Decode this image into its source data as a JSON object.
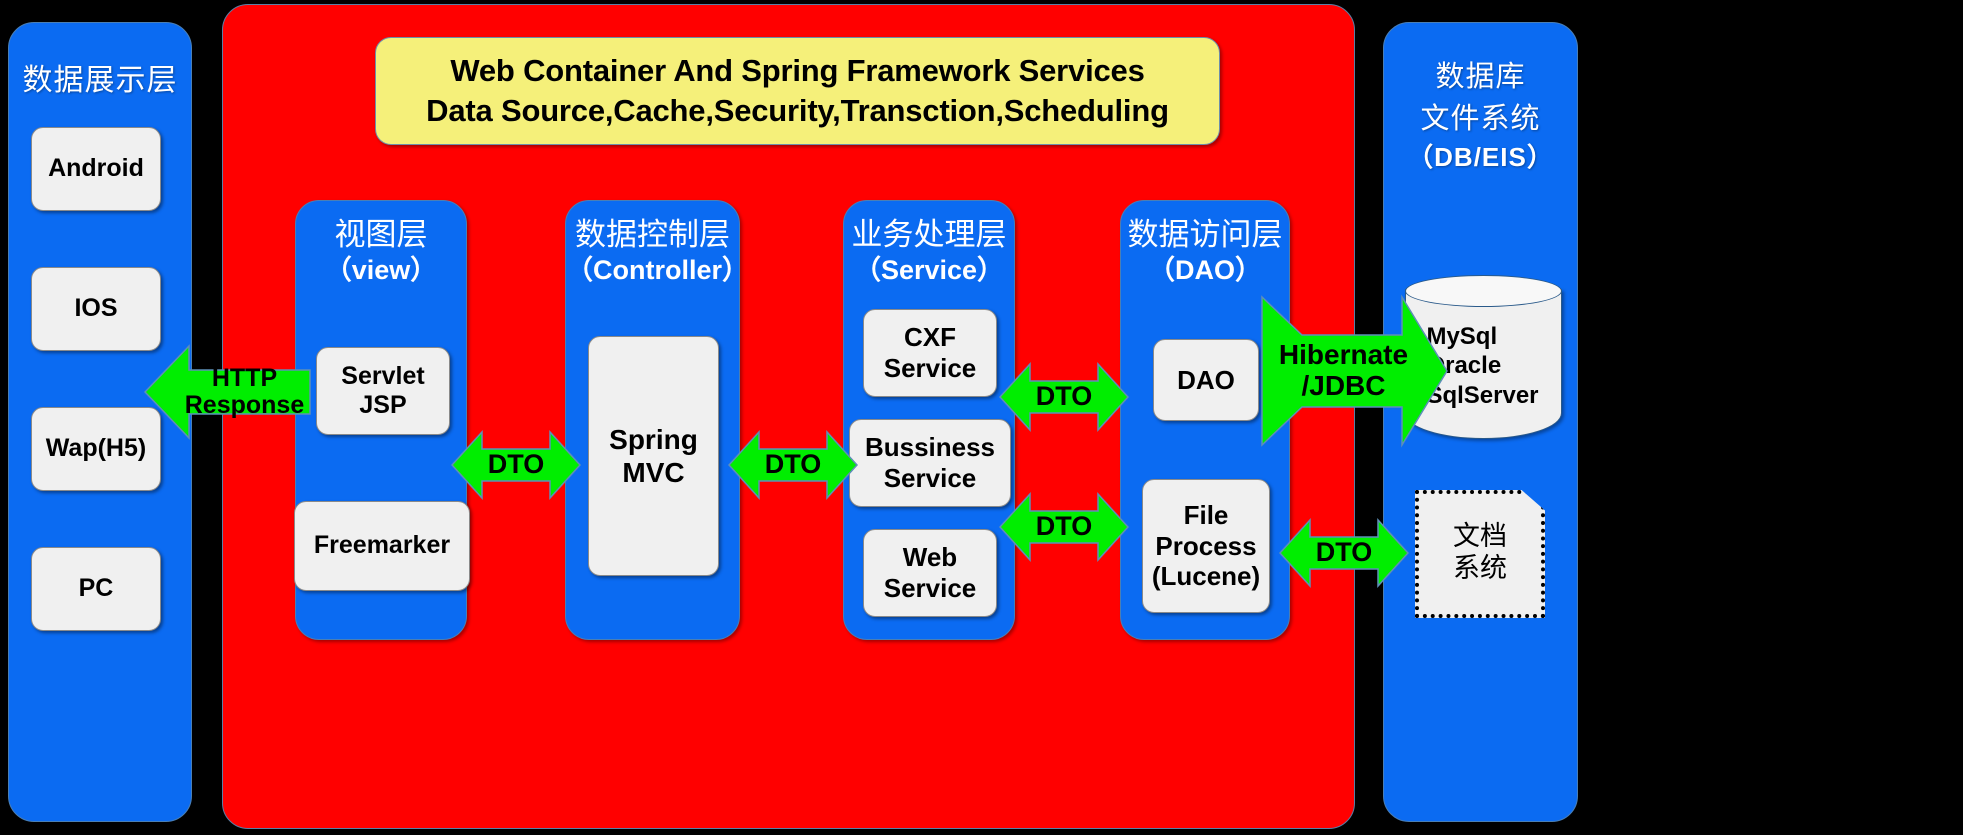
{
  "presentation": {
    "title": "数据展示层",
    "clients": [
      {
        "label": "Android"
      },
      {
        "label": "IOS"
      },
      {
        "label": "Wap(H5)"
      },
      {
        "label": "PC"
      }
    ]
  },
  "container": {
    "banner": {
      "line1": "Web Container And Spring Framework Services",
      "line2": "Data Source,Cache,Security,Transction,Scheduling",
      "color": "#F5F07A"
    },
    "layers": [
      {
        "id": "view",
        "title_cn": "视图层",
        "title_en": "（view）",
        "items": [
          {
            "label": "Servlet\nJSP"
          },
          {
            "label": "Freemarker"
          }
        ]
      },
      {
        "id": "controller",
        "title_cn": "数据控制层",
        "title_en": "（Controller）",
        "items": [
          {
            "label": "Spring\nMVC"
          }
        ]
      },
      {
        "id": "service",
        "title_cn": "业务处理层",
        "title_en": "（Service）",
        "items": [
          {
            "label": "CXF\nService"
          },
          {
            "label": "Bussiness\nService"
          },
          {
            "label": "Web\nService"
          }
        ]
      },
      {
        "id": "dao",
        "title_cn": "数据访问层",
        "title_en": "（DAO）",
        "items": [
          {
            "label": "DAO"
          },
          {
            "label": "File\nProcess\n(Lucene)"
          }
        ]
      }
    ]
  },
  "database": {
    "title_cn1": "数据库",
    "title_cn2": "文件系统",
    "title_en": "（DB/EIS）",
    "mysql": "MySql\nOracle\nSqlServer",
    "document": "文档\n系统"
  },
  "arrows": {
    "http_response": "HTTP\nResponse",
    "dto_view_controller": "DTO",
    "dto_controller_service": "DTO",
    "dto_service_dao_top": "DTO",
    "dto_service_dao_bottom": "DTO",
    "hibernate": "Hibernate\n/JDBC",
    "dto_file_document": "DTO"
  },
  "colors": {
    "background": "#000000",
    "panel_blue": "#0B6BF2",
    "container_red": "#FF0000",
    "arrow_green": "#00EE00",
    "card_grey": "#F0F0F0",
    "banner_yellow": "#F5F07A",
    "text_white": "#FFFFFF"
  }
}
